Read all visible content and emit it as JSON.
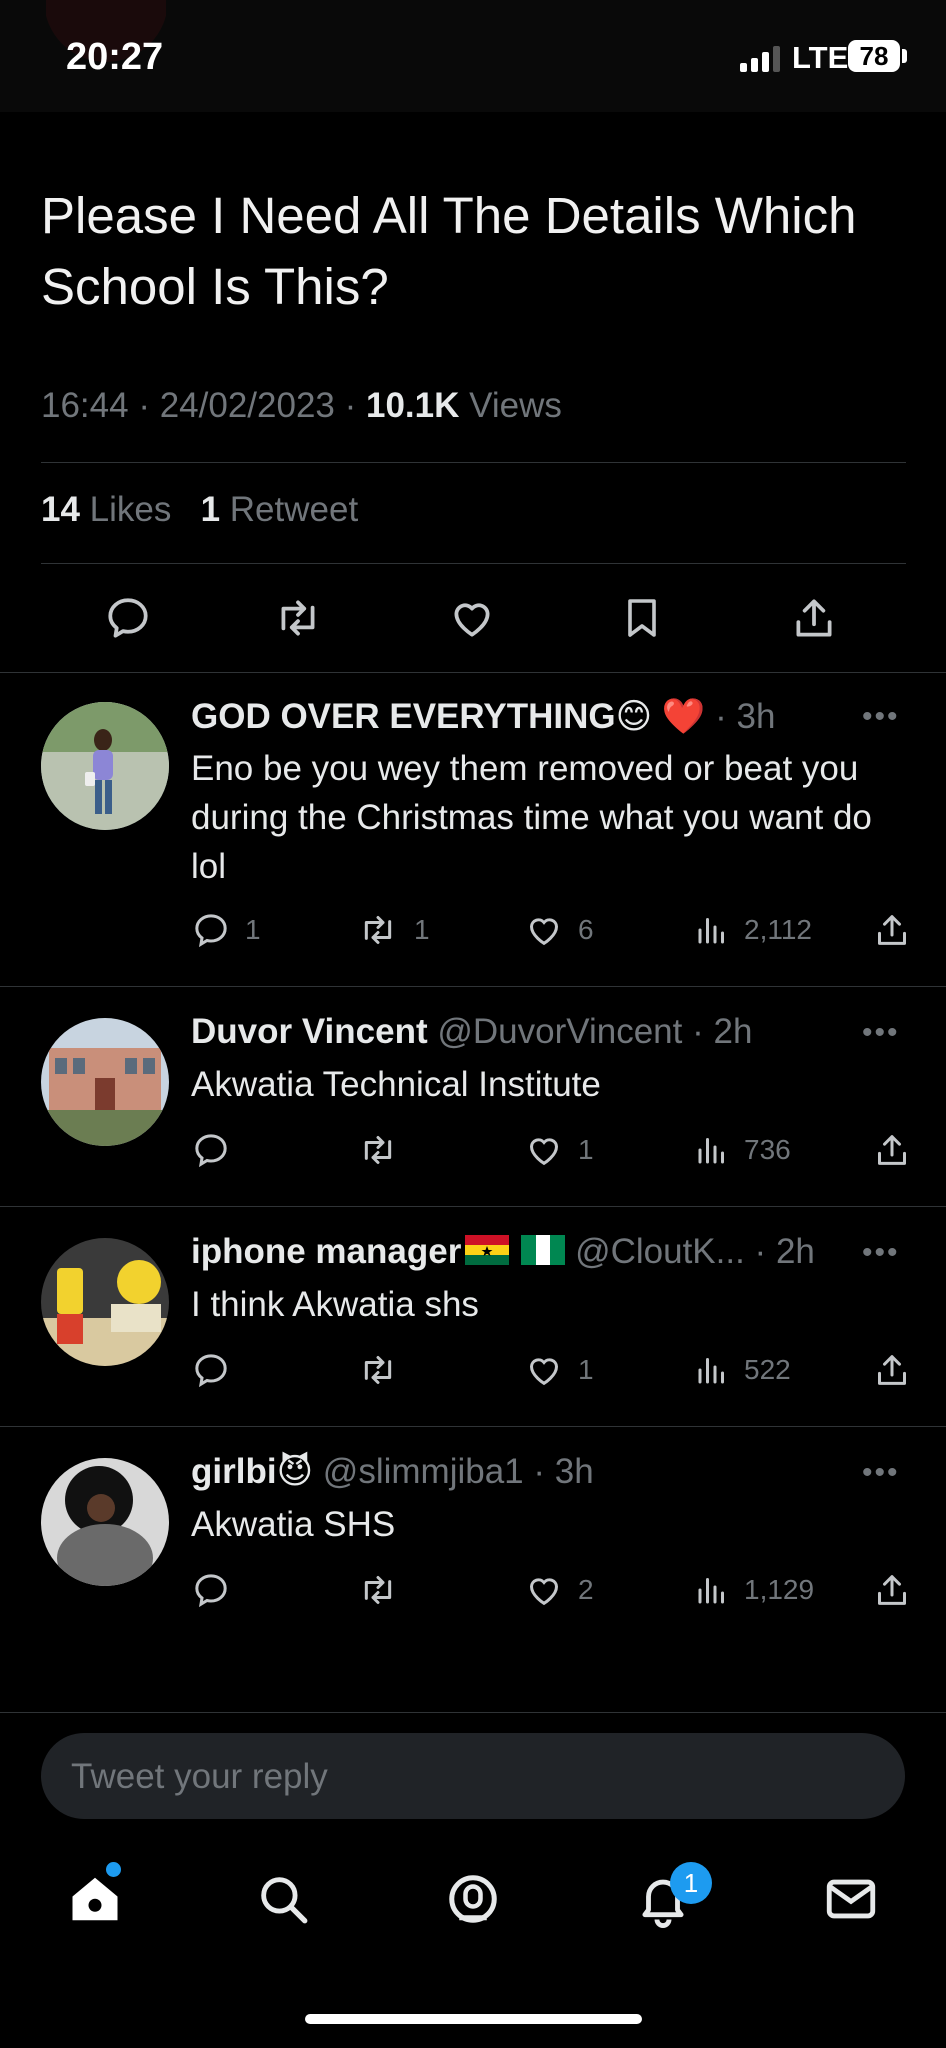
{
  "status_bar": {
    "time": "20:27",
    "network": "LTE",
    "battery": "78"
  },
  "tweet": {
    "text": "Please I Need All The Details Which School Is This?",
    "time": "16:44",
    "date": "24/02/2023",
    "views_count": "10.1K",
    "views_label": "Views",
    "likes_count": "14",
    "likes_label": "Likes",
    "retweets_count": "1",
    "retweets_label": "Retweet"
  },
  "replies": [
    {
      "name": "GOD OVER EVERYTHING",
      "name_suffix": "😊 ❤️",
      "handle": "",
      "time": "3h",
      "text": "Eno be you wey them removed or beat you during the Christmas time what you want do lol",
      "reply_count": "1",
      "retweet_count": "1",
      "like_count": "6",
      "view_count": "2,112"
    },
    {
      "name": "Duvor Vincent",
      "name_suffix": "",
      "handle": "@DuvorVincent",
      "time": "2h",
      "text": "Akwatia Technical Institute",
      "reply_count": "",
      "retweet_count": "",
      "like_count": "1",
      "view_count": "736"
    },
    {
      "name": "iphone manager",
      "name_suffix": "",
      "handle": "@CloutK...",
      "time": "2h",
      "text": "I think Akwatia shs",
      "reply_count": "",
      "retweet_count": "",
      "like_count": "1",
      "view_count": "522"
    },
    {
      "name": "girlbi",
      "name_suffix": "😈",
      "handle": "@slimmjiba1",
      "time": "3h",
      "text": "Akwatia SHS",
      "reply_count": "",
      "retweet_count": "",
      "like_count": "2",
      "view_count": "1,129"
    }
  ],
  "reply_box": {
    "placeholder": "Tweet your reply"
  },
  "bottom_nav": {
    "notifications_badge": "1"
  },
  "colors": {
    "background": "#000000",
    "muted": "#71767b",
    "accent": "#1d9bf0"
  }
}
